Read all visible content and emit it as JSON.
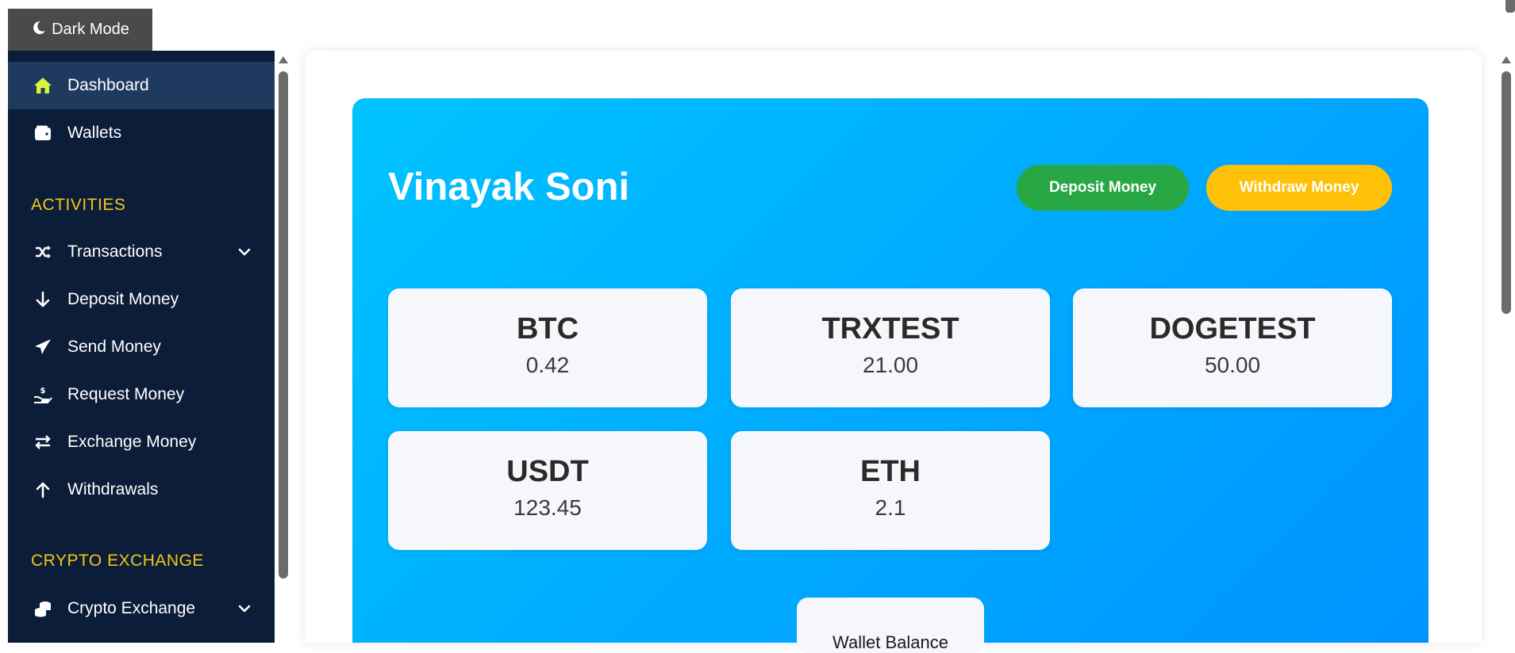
{
  "dark_mode_button": {
    "label": "Dark Mode",
    "icon": "moon-icon"
  },
  "sidebar": {
    "items": [
      {
        "label": "Dashboard",
        "icon": "home-icon",
        "active": true
      },
      {
        "label": "Wallets",
        "icon": "wallet-icon"
      }
    ],
    "sections": [
      {
        "title": "ACTIVITIES",
        "items": [
          {
            "label": "Transactions",
            "icon": "shuffle-icon",
            "has_submenu": true
          },
          {
            "label": "Deposit Money",
            "icon": "arrow-down-icon"
          },
          {
            "label": "Send Money",
            "icon": "paper-plane-icon"
          },
          {
            "label": "Request Money",
            "icon": "hand-coin-icon"
          },
          {
            "label": "Exchange Money",
            "icon": "exchange-icon"
          },
          {
            "label": "Withdrawals",
            "icon": "arrow-up-icon"
          }
        ]
      },
      {
        "title": "CRYPTO EXCHANGE",
        "items": [
          {
            "label": "Crypto Exchange",
            "icon": "coins-icon",
            "has_submenu": true
          }
        ]
      }
    ]
  },
  "main": {
    "user_name": "Vinayak Soni",
    "deposit_label": "Deposit Money",
    "withdraw_label": "Withdraw Money",
    "balances": [
      {
        "symbol": "BTC",
        "amount": "0.42"
      },
      {
        "symbol": "TRXTEST",
        "amount": "21.00"
      },
      {
        "symbol": "DOGETEST",
        "amount": "50.00"
      },
      {
        "symbol": "USDT",
        "amount": "123.45"
      },
      {
        "symbol": "ETH",
        "amount": "2.1"
      }
    ],
    "wallet_balance_label": "Wallet Balance"
  },
  "colors": {
    "sidebar_bg": "#0b1d38",
    "sidebar_active": "#1f3a5f",
    "section_title": "#f5c518",
    "active_icon": "#d4f53c",
    "hero_gradient_start": "#00c3ff",
    "hero_gradient_end": "#0093ff",
    "deposit_button": "#28a745",
    "withdraw_button": "#ffc107"
  }
}
